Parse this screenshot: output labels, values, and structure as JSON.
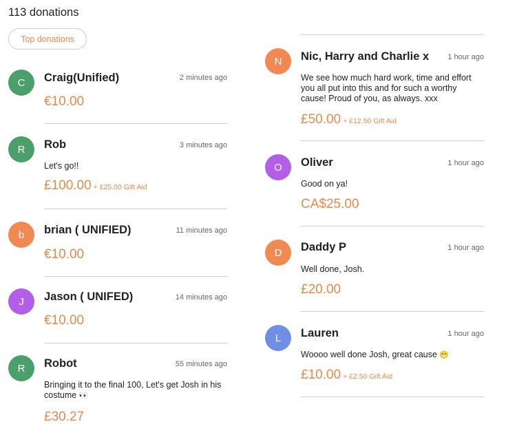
{
  "header": {
    "count_label": "113 donations",
    "top_button_label": "Top donations"
  },
  "colors": {
    "accent": "#e8894a",
    "green": "#4a9f6b",
    "orange": "#f08a52",
    "purple": "#b35ee8",
    "blue": "#6f8ee6"
  },
  "donations": [
    {
      "initial": "C",
      "avatar_color": "green",
      "name": "Craig(Unified)",
      "time": "2 minutes ago",
      "message": "",
      "amount": "€10.00",
      "gift_aid": ""
    },
    {
      "initial": "R",
      "avatar_color": "green",
      "name": "Rob",
      "time": "3 minutes ago",
      "message": "Let's go!!",
      "amount": "£100.00",
      "gift_aid": "+ £25.00 Gift Aid"
    },
    {
      "initial": "b",
      "avatar_color": "orange",
      "name": "brian ( UNIFIED)",
      "time": "11 minutes ago",
      "message": "",
      "amount": "€10.00",
      "gift_aid": ""
    },
    {
      "initial": "J",
      "avatar_color": "purple",
      "name": "Jason ( UNIFED)",
      "time": "14 minutes ago",
      "message": "",
      "amount": "€10.00",
      "gift_aid": ""
    },
    {
      "initial": "R",
      "avatar_color": "green",
      "name": "Robot",
      "time": "55 minutes ago",
      "message": "Bringing it to the final 100, Let's get Josh in his costume",
      "message_emoji": "👀",
      "amount": "£30.27",
      "gift_aid": ""
    },
    {
      "initial": "N",
      "avatar_color": "orange",
      "name": "Nic, Harry and Charlie x",
      "time": "1 hour ago",
      "message": "We see how much hard work, time and effort you all put into this and for such a worthy cause! Proud of you, as always. xxx",
      "amount": "£50.00",
      "gift_aid": "+ £12.50 Gift Aid"
    },
    {
      "initial": "O",
      "avatar_color": "purple",
      "name": "Oliver",
      "time": "1 hour ago",
      "message": "Good on ya!",
      "amount": "CA$25.00",
      "gift_aid": ""
    },
    {
      "initial": "D",
      "avatar_color": "orange",
      "name": "Daddy P",
      "time": "1 hour ago",
      "message": "Well done, Josh.",
      "amount": "£20.00",
      "gift_aid": ""
    },
    {
      "initial": "L",
      "avatar_color": "blue",
      "name": "Lauren",
      "time": "1 hour ago",
      "message": "Woooo well done Josh, great cause",
      "message_emoji": "😁",
      "amount": "£10.00",
      "gift_aid": "+ £2.50 Gift Aid"
    }
  ]
}
